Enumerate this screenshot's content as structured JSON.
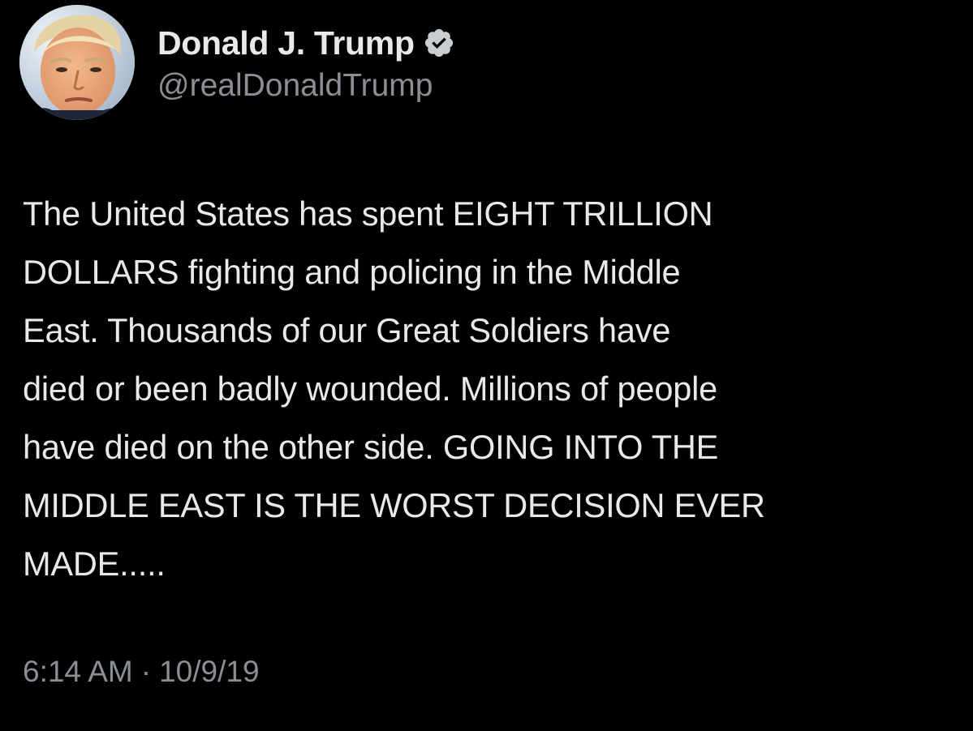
{
  "author": {
    "display_name": "Donald J. Trump",
    "handle": "@realDonaldTrump",
    "verified": true,
    "verified_badge_icon": "verified-badge-icon",
    "avatar_icon": "avatar-portrait"
  },
  "tweet": {
    "text": "The United States has spent EIGHT TRILLION\nDOLLARS fighting and policing in the Middle\nEast. Thousands of our Great Soldiers have\ndied or been badly wounded. Millions of people\nhave died on the other side. GOING INTO THE\nMIDDLE EAST IS THE WORST DECISION EVER\nMADE.....",
    "time": "6:14 AM",
    "separator": "·",
    "date": "10/9/19"
  },
  "colors": {
    "background": "#000000",
    "primary_text": "#e7e9ea",
    "secondary_text": "#8b8f94",
    "badge": "#c9cdd2"
  }
}
